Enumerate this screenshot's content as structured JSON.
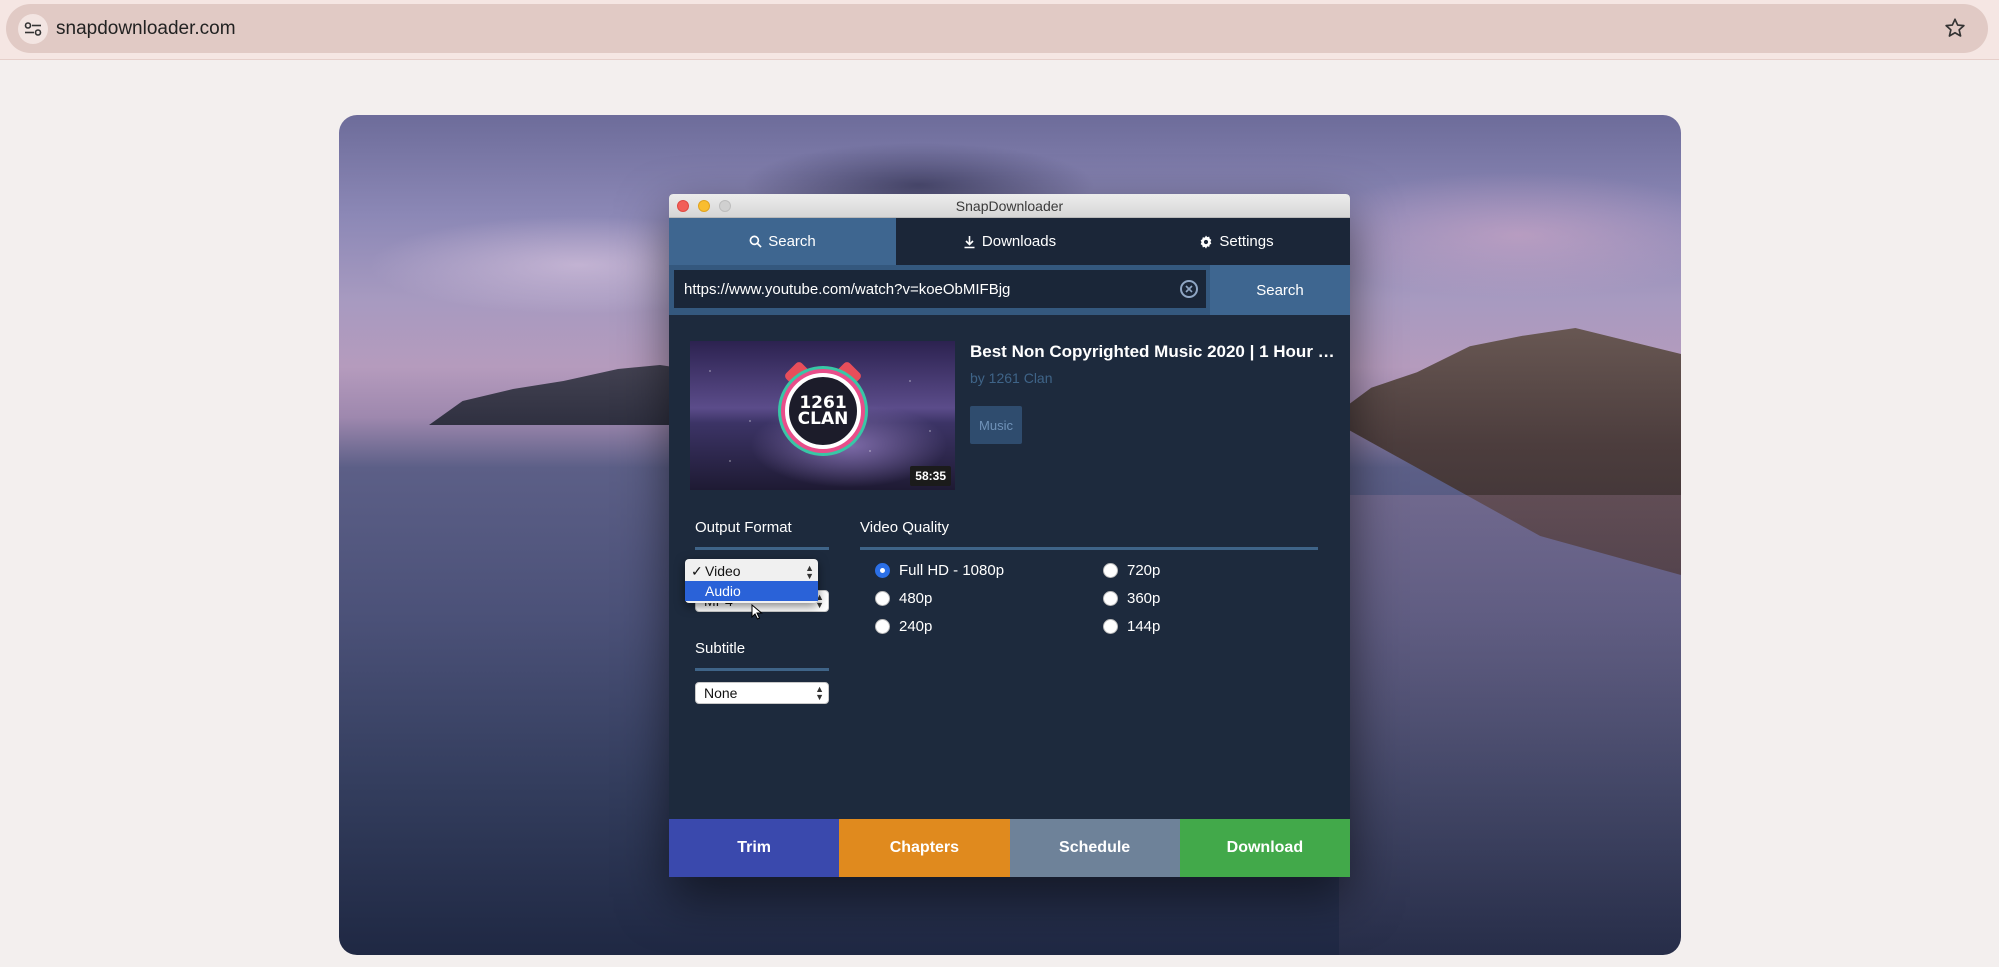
{
  "browser": {
    "url": "snapdownloader.com"
  },
  "app": {
    "window_title": "SnapDownloader",
    "tabs": [
      {
        "label": "Search",
        "icon": "search-icon"
      },
      {
        "label": "Downloads",
        "icon": "download-icon"
      },
      {
        "label": "Settings",
        "icon": "gear-icon"
      }
    ],
    "search": {
      "value": "https://www.youtube.com/watch?v=koeObMIFBjg",
      "button_label": "Search"
    },
    "video": {
      "title": "Best Non Copyrighted Music 2020 | 1 Hour C...",
      "author": "by 1261 Clan",
      "tag": "Music",
      "duration": "58:35",
      "thumb_text_line1": "1261",
      "thumb_text_line2": "CLAN"
    },
    "output_format": {
      "label": "Output Format",
      "options": [
        "Video",
        "Audio"
      ],
      "selected": "Video",
      "highlighted": "Audio",
      "container_value": "MP4"
    },
    "subtitle": {
      "label": "Subtitle",
      "value": "None"
    },
    "video_quality": {
      "label": "Video Quality",
      "options": [
        "Full HD - 1080p",
        "720p",
        "480p",
        "360p",
        "240p",
        "144p"
      ],
      "selected": "Full HD - 1080p"
    },
    "actions": [
      {
        "label": "Trim",
        "color": "#3a49ad"
      },
      {
        "label": "Chapters",
        "color": "#e08a1e"
      },
      {
        "label": "Schedule",
        "color": "#6e8299"
      },
      {
        "label": "Download",
        "color": "#42a94a"
      }
    ]
  }
}
